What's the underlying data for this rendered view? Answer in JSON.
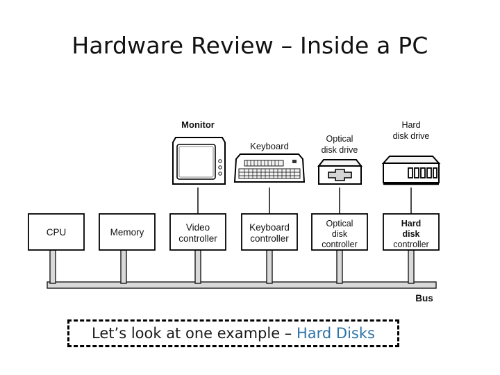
{
  "slide": {
    "title": "Hardware Review – Inside a PC",
    "background_color": "#ffffff"
  },
  "colors": {
    "ink": "#000000",
    "text": "#1a1a1a",
    "bus_fill": "#d9d9d9",
    "bus_edge": "#1a1a1a",
    "highlight_blue": "#2f73a7",
    "device_fill": "#ffffff",
    "device_shade": "#efefef"
  },
  "diagram": {
    "name": "inside-a-pc-block-diagram",
    "bus_label": "Bus",
    "devices": [
      {
        "id": "monitor",
        "label": "Monitor",
        "label_lines": [
          "Monitor"
        ],
        "icon": "crt-monitor-icon",
        "bold": true
      },
      {
        "id": "keyboard",
        "label": "Keyboard",
        "label_lines": [
          "Keyboard"
        ],
        "icon": "keyboard-icon",
        "bold": false
      },
      {
        "id": "optical-disk-drive",
        "label": "Optical disk drive",
        "label_lines": [
          "Optical",
          "disk drive"
        ],
        "icon": "optical-disk-drive-icon",
        "bold": false
      },
      {
        "id": "hard-disk-drive",
        "label": "Hard disk drive",
        "label_lines": [
          "Hard",
          "disk drive"
        ],
        "icon": "hard-disk-drive-icon",
        "bold": false
      }
    ],
    "components": [
      {
        "id": "cpu",
        "label": "CPU",
        "label_lines": [
          "CPU"
        ],
        "connects_to_device": null
      },
      {
        "id": "memory",
        "label": "Memory",
        "label_lines": [
          "Memory"
        ],
        "connects_to_device": null
      },
      {
        "id": "video-controller",
        "label": "Video controller",
        "label_lines": [
          "Video",
          "controller"
        ],
        "connects_to_device": "monitor"
      },
      {
        "id": "keyboard-controller",
        "label": "Keyboard controller",
        "label_lines": [
          "Keyboard",
          "controller"
        ],
        "connects_to_device": "keyboard"
      },
      {
        "id": "optical-disk-controller",
        "label": "Optical disk controller",
        "label_lines": [
          "Optical",
          "disk",
          "controller"
        ],
        "connects_to_device": "optical-disk-drive"
      },
      {
        "id": "hard-disk-controller",
        "label": "Hard disk controller",
        "label_lines": [
          "Hard",
          "disk",
          "controller"
        ],
        "connects_to_device": "hard-disk-drive"
      }
    ]
  },
  "callout": {
    "prefix": "Let’s look at one example – ",
    "highlight": "Hard Disks",
    "full_text": "Let’s look at one example – Hard Disks"
  }
}
